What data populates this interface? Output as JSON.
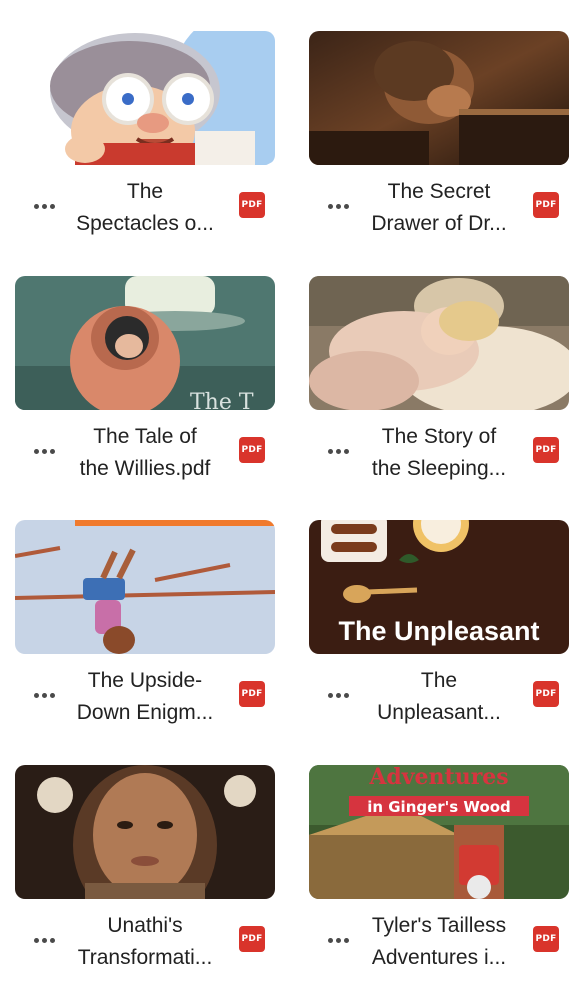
{
  "files": [
    {
      "title": "The\nSpectacles o...",
      "badge": "PDF",
      "thumb_icon": "grandma-glasses-illustration"
    },
    {
      "title": "The Secret\nDrawer of Dr...",
      "badge": "PDF",
      "thumb_icon": "dark-woman-drawer-photo"
    },
    {
      "title": "The Tale of\nthe Willies.pdf",
      "badge": "PDF",
      "thumb_icon": "hooded-child-illustration",
      "thumb_text": "The T"
    },
    {
      "title": "The Story of\nthe Sleeping...",
      "badge": "PDF",
      "thumb_icon": "sleeping-girl-dog-photo"
    },
    {
      "title": "The Upside-\nDown Enigm...",
      "badge": "PDF",
      "thumb_icon": "upside-down-child-illustration"
    },
    {
      "title": "The\nUnpleasant...",
      "badge": "PDF",
      "thumb_icon": "unpleasant-food-cover",
      "thumb_text": "The Unpleasant"
    },
    {
      "title": "Unathi's\nTransformati...",
      "badge": "PDF",
      "thumb_icon": "woman-portrait-photo"
    },
    {
      "title": "Tyler's Tailless\nAdventures i...",
      "badge": "PDF",
      "thumb_icon": "gingers-wood-cover",
      "thumb_text": "Adventures",
      "thumb_text2": "in Ginger's Wood"
    }
  ],
  "colors": {
    "pdf_badge": "#d9342b",
    "more_dots": "#4a4a4a"
  }
}
